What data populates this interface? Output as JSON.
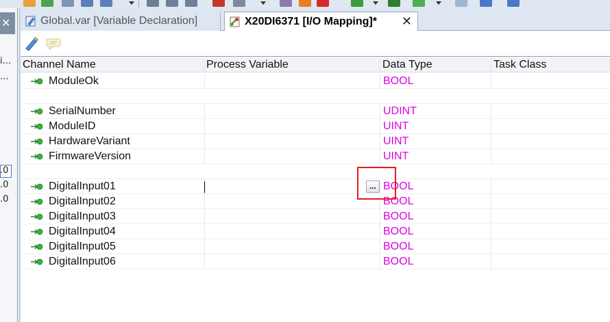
{
  "tabs": [
    {
      "label": "Global.var [Variable Declaration]",
      "active": false
    },
    {
      "label": "X20DI6371 [I/O Mapping]*",
      "active": true
    }
  ],
  "tab_close_glyph": "✕",
  "left_panel": {
    "close_glyph": "✕",
    "text1": "i...",
    "text2": "...",
    "values": [
      ".0",
      ".0",
      ".0"
    ]
  },
  "columns": [
    "Channel Name",
    "Process Variable",
    "Data Type",
    "Task Class"
  ],
  "rows": [
    {
      "name": "ModuleOk",
      "type": "BOOL"
    },
    {
      "name": "SerialNumber",
      "type": "UDINT"
    },
    {
      "name": "ModuleID",
      "type": "UINT"
    },
    {
      "name": "HardwareVariant",
      "type": "UINT"
    },
    {
      "name": "FirmwareVersion",
      "type": "UINT"
    },
    {
      "name": "DigitalInput01",
      "type": "BOOL"
    },
    {
      "name": "DigitalInput02",
      "type": "BOOL"
    },
    {
      "name": "DigitalInput03",
      "type": "BOOL"
    },
    {
      "name": "DigitalInput04",
      "type": "BOOL"
    },
    {
      "name": "DigitalInput05",
      "type": "BOOL"
    },
    {
      "name": "DigitalInput06",
      "type": "BOOL"
    }
  ],
  "ellipsis_label": "...",
  "colors": {
    "data_type_text": "#e000e0",
    "highlight": "#e8191a",
    "channel_icon": "#2fa82f"
  },
  "icons": [
    "declare-variable-icon",
    "comment-icon",
    "channel-input-icon",
    "variable-file-icon",
    "io-mapping-icon"
  ]
}
